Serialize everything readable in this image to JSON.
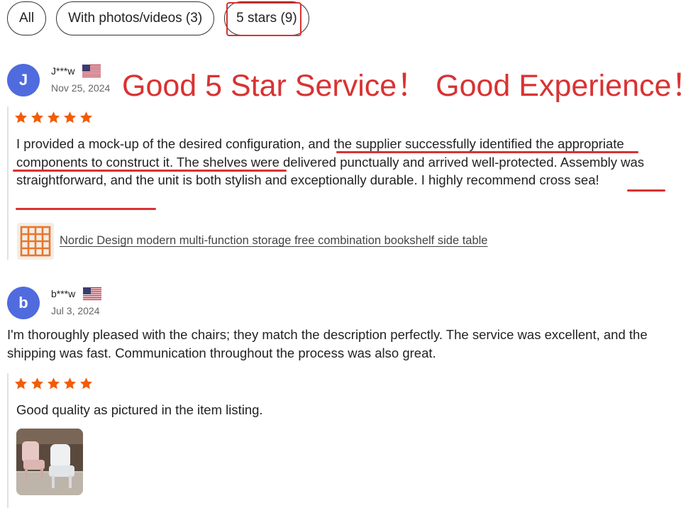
{
  "filters": {
    "all": "All",
    "photos": "With photos/videos (3)",
    "five_stars": "5 stars (9)"
  },
  "annotation": "Good 5 Star Service！ Good Experience！",
  "reviews": [
    {
      "avatar_letter": "J",
      "name": "J***w",
      "date": "Nov 25, 2024",
      "rating": 5,
      "text": "I provided a mock-up of the desired configuration, and the supplier successfully identified the appropriate components to construct it. The shelves were delivered punctually and arrived well-protected. Assembly was straightforward, and the unit is both stylish and exceptionally durable. I highly recommend cross sea!",
      "product_link": "Nordic Design modern multi-function storage free combination bookshelf side table"
    },
    {
      "avatar_letter": "b",
      "name": "b***w",
      "date": "Jul 3, 2024",
      "main_text": "I'm thoroughly pleased with the chairs; they match the description perfectly. The service was excellent, and the shipping was fast. Communication throughout the process was also great.",
      "rating": 5,
      "text": "Good quality as pictured in the item listing."
    }
  ],
  "colors": {
    "accent_red": "#d93232",
    "star_orange": "#f25c05",
    "avatar_blue": "#4f6bde"
  }
}
